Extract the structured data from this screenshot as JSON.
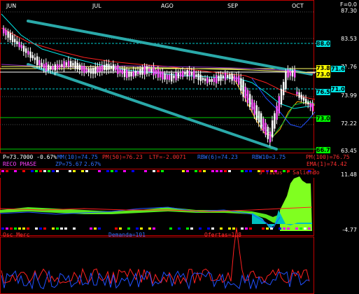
{
  "months": [
    "JUN",
    "JUL",
    "AGO",
    "SEP",
    "OCT"
  ],
  "top_right": "F=0.0",
  "y_axis": [
    "87.30",
    "83.53",
    "71.76",
    "73.99",
    "72.22",
    "63.45"
  ],
  "price_tags": [
    {
      "text": "88.09",
      "color": "#00e6e6"
    },
    {
      "text": "73.85",
      "color": "#ffff00"
    },
    {
      "text": "71.66",
      "color": "#00e6e6"
    },
    {
      "text": "73.01",
      "color": "#ffff00"
    },
    {
      "text": "76.56",
      "color": "#00e6e6"
    },
    {
      "text": "71.00",
      "color": "#00e6e6"
    },
    {
      "text": "73.07",
      "color": "#00ff00"
    },
    {
      "text": "66.73",
      "color": "#00ff00"
    }
  ],
  "indicators_row1": {
    "p": "P=73.7000 -0.67%",
    "mm": "MM(10)=74.75",
    "pm50": "PM(50)=76.23",
    "ltf": "LTF=-2.0071",
    "rbw6": "RBW(6)=74.23",
    "rbw10": "RBW10=3.75",
    "pm100": "PM(100)=76.75",
    "ema": "EMA(1)=74.42"
  },
  "indicators_row2": {
    "reco": "RECO PHASE",
    "zp": "ZP=75.67",
    "pct": "2.67%"
  },
  "osc_panel": {
    "title": "3 Tibus - Saliendo",
    "axis_top": "11.48",
    "axis_bottom": "-4.77"
  },
  "bottom_panel": {
    "left": "Osc Merc",
    "demanda": "Demanda=101",
    "ofertas": "Ofertas=1.8"
  },
  "colors": {
    "candle_up": "#ff55ff",
    "candle_down": "#ffffff",
    "channel": "#2aa9a9",
    "ma_red": "#ff2020",
    "ma_orange": "#ffb000",
    "ma_cyan": "#00e6e6",
    "ma_blue": "#2050ff",
    "ma_green": "#00c040"
  }
}
